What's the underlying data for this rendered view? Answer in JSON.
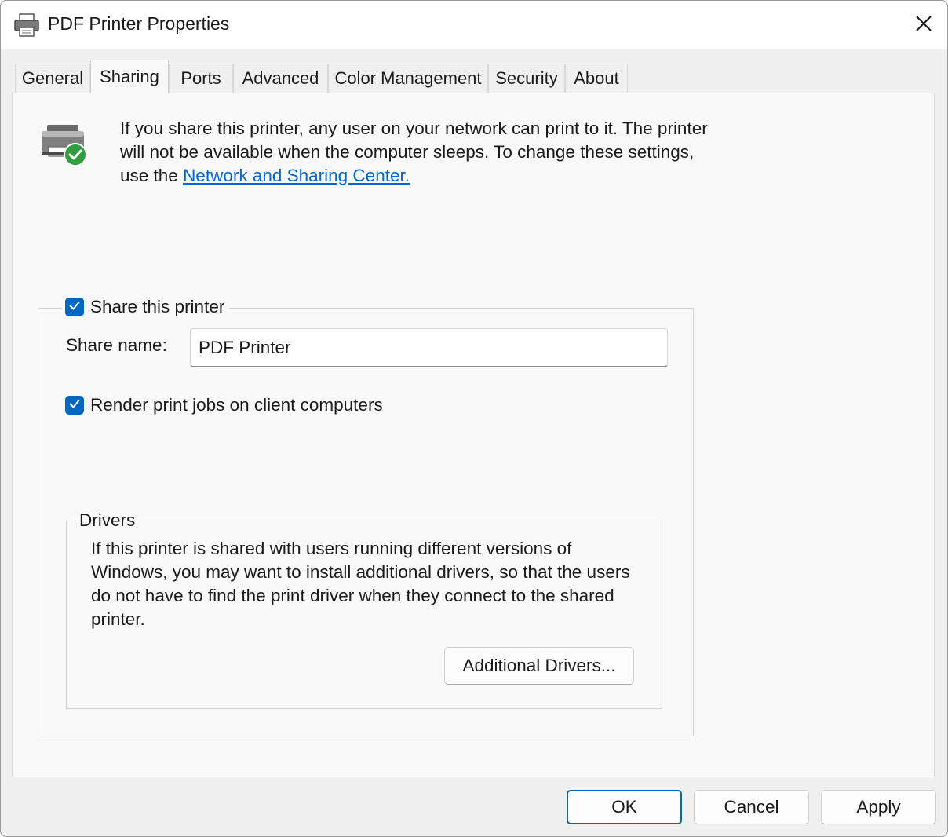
{
  "window": {
    "title": "PDF Printer Properties",
    "title_icon": "printer-icon",
    "close_icon": "close-icon"
  },
  "tabs": [
    {
      "label": "General",
      "active": false
    },
    {
      "label": "Sharing",
      "active": true
    },
    {
      "label": "Ports",
      "active": false
    },
    {
      "label": "Advanced",
      "active": false
    },
    {
      "label": "Color Management",
      "active": false
    },
    {
      "label": "Security",
      "active": false
    },
    {
      "label": "About",
      "active": false
    }
  ],
  "sharing": {
    "intro_text": "If you share this printer, any user on your network can print to it. The printer will not be available when the computer sleeps. To change these settings, use the ",
    "intro_link": "Network and Sharing Center.",
    "share_checkbox_label": "Share this printer",
    "share_checked": true,
    "share_name_label": "Share name:",
    "share_name_value": "PDF Printer",
    "render_checkbox_label": "Render print jobs on client computers",
    "render_checked": true
  },
  "drivers": {
    "legend": "Drivers",
    "text": "If this printer is shared with users running different versions of Windows, you may want to install additional drivers, so that the users do not have to find the print driver when they connect to the shared printer.",
    "button_label": "Additional Drivers..."
  },
  "footer": {
    "ok_label": "OK",
    "cancel_label": "Cancel",
    "apply_label": "Apply"
  },
  "colors": {
    "accent": "#0067c0",
    "link": "#0066cc",
    "success": "#2e9e3e"
  }
}
